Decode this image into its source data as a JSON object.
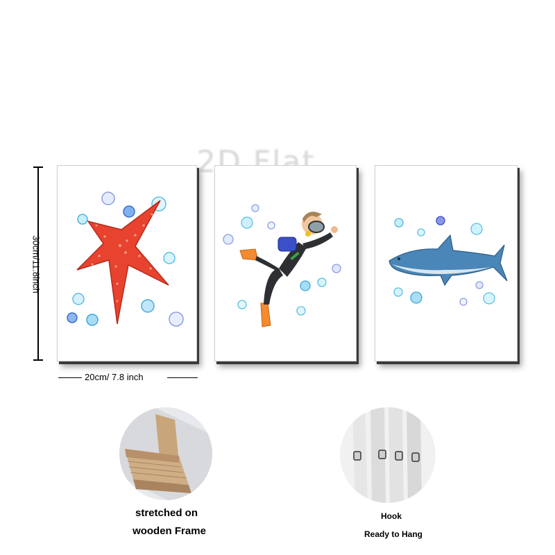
{
  "watermark": "2D Flat",
  "dimensions": {
    "height_label": "30cm/11.8inch",
    "width_label": "20cm/ 7.8 inch"
  },
  "panels": [
    {
      "subject": "starfish"
    },
    {
      "subject": "scuba diver"
    },
    {
      "subject": "shark"
    }
  ],
  "features": {
    "frame": {
      "line1": "stretched on",
      "line2": "wooden Frame"
    },
    "hook": {
      "line1": "Hook",
      "line2": "Ready to Hang"
    }
  },
  "colors": {
    "starfish": "#e8432f",
    "shark": "#4a86b8",
    "bubbles": "#5bbfe0",
    "wood": "#c9a57a"
  }
}
